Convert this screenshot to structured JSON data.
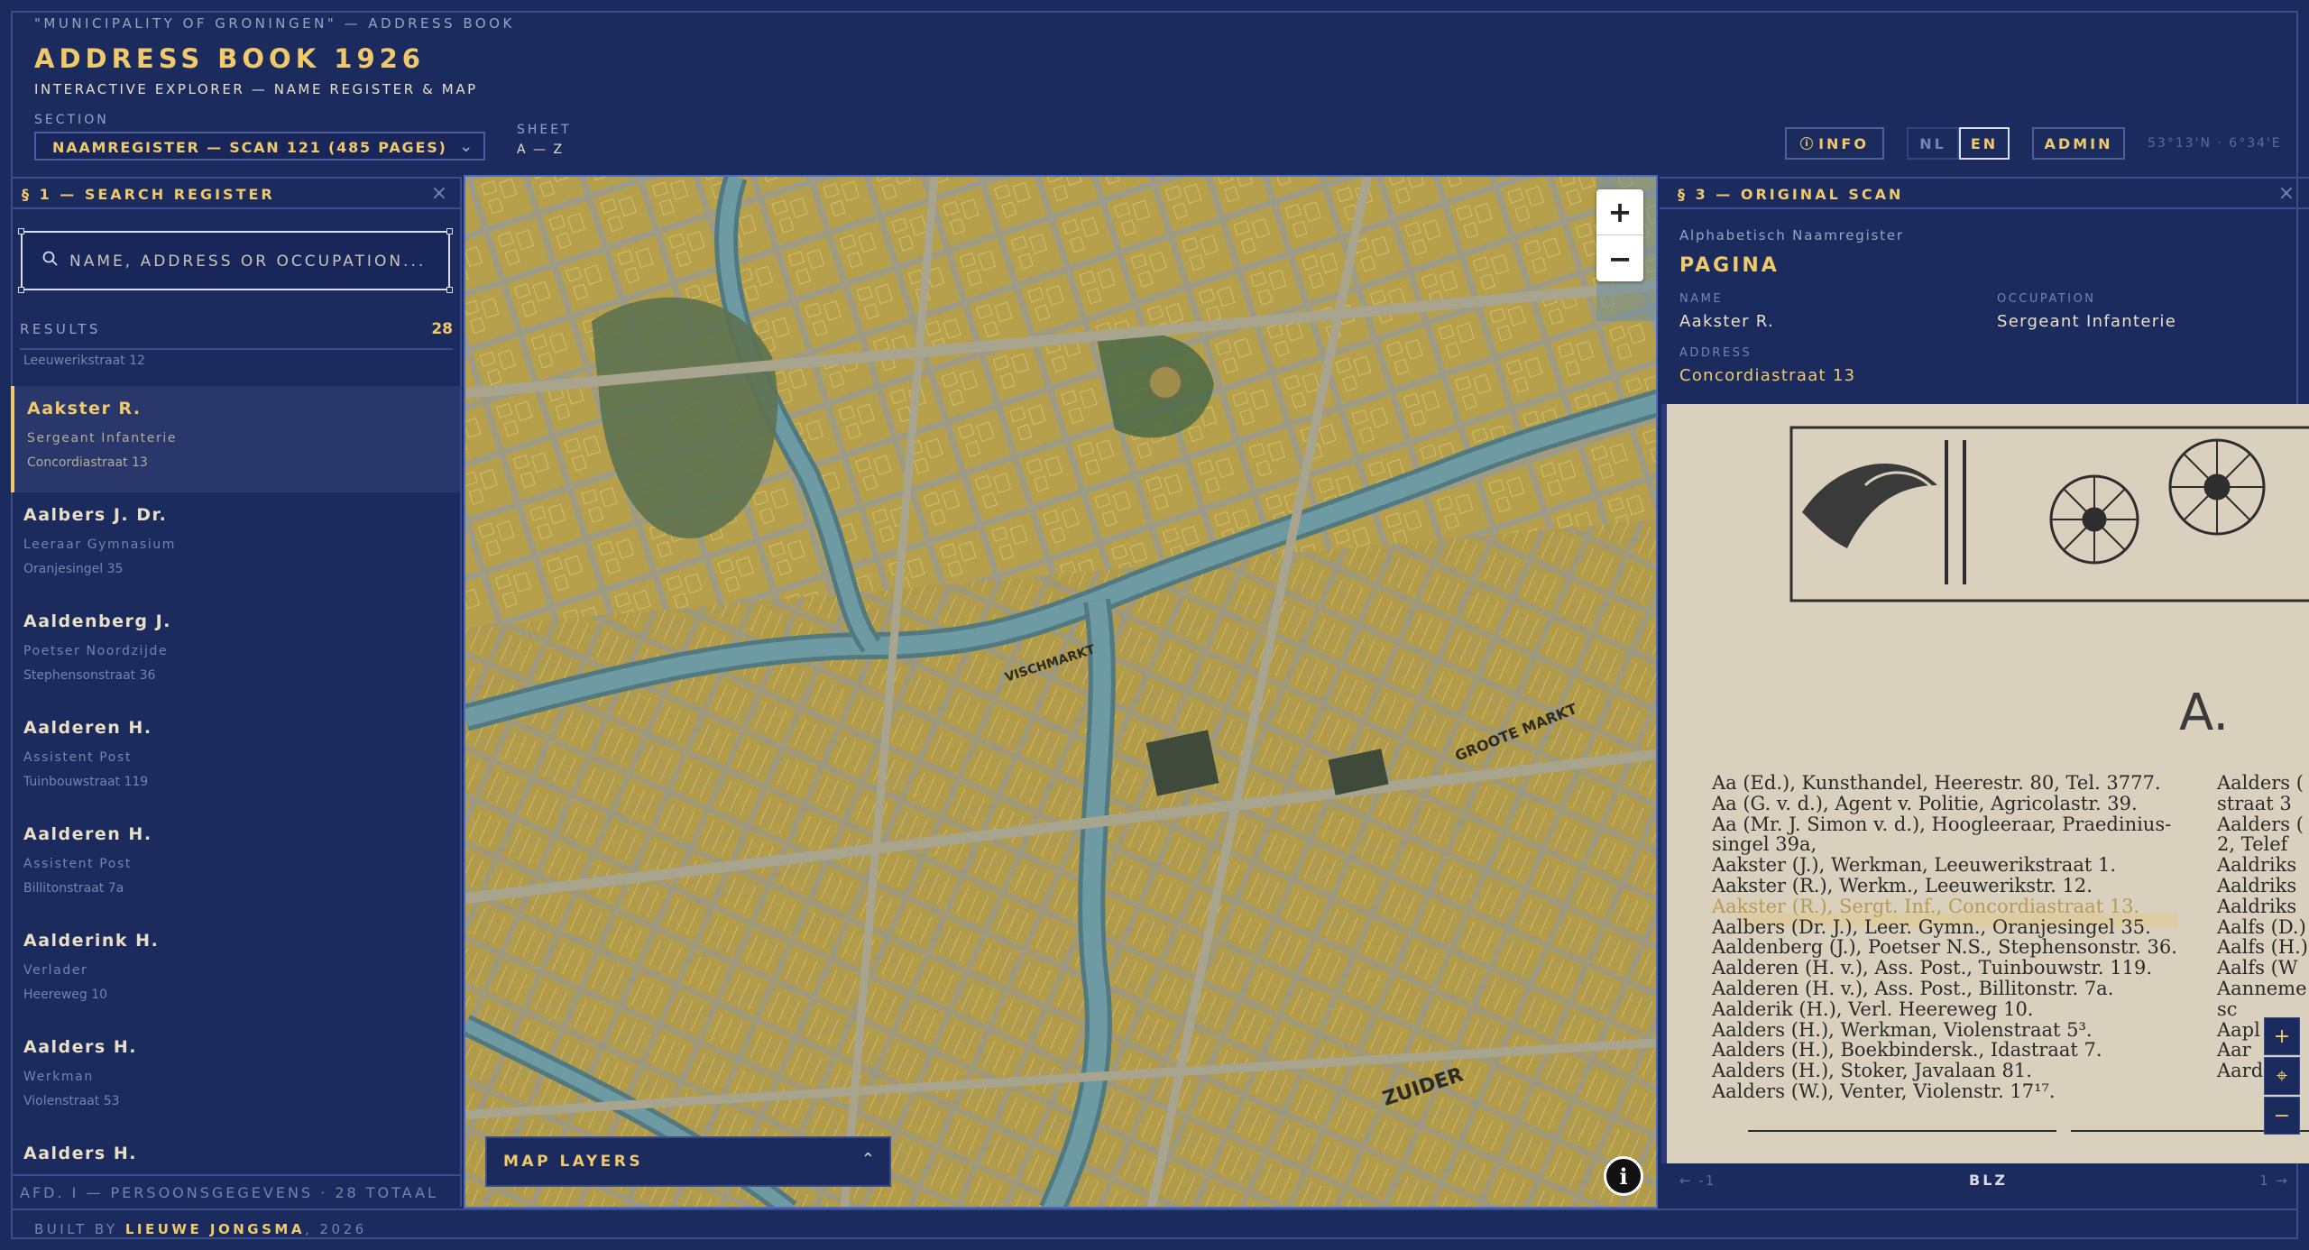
{
  "header": {
    "kicker": "\"MUNICIPALITY OF GRONINGEN\" — ADDRESS BOOK",
    "title": "ADDRESS BOOK 1926",
    "subtitle": "INTERACTIVE EXPLORER — NAME REGISTER & MAP",
    "section_label": "SECTION",
    "section_value": "NAAMREGISTER — SCAN 121 (485 PAGES)",
    "sheet_label": "SHEET",
    "sheet_value": "A — Z",
    "info_label": "INFO",
    "lang_nl": "NL",
    "lang_en": "EN",
    "lang_active": "EN",
    "admin_label": "ADMIN",
    "coords": "53°13'N · 6°34'E"
  },
  "search_panel": {
    "title": "§ 1 — SEARCH REGISTER",
    "close": "×",
    "search_placeholder": "NAME, ADDRESS OR OCCUPATION...",
    "results_label": "RESULTS",
    "results_count": "28",
    "partial_top": "Leeuwerikstraat 12",
    "items": [
      {
        "name": "Aakster R.",
        "occupation": "Sergeant Infanterie",
        "address": "Concordiastraat 13",
        "active": true
      },
      {
        "name": "Aalbers J. Dr.",
        "occupation": "Leeraar Gymnasium",
        "address": "Oranjesingel 35"
      },
      {
        "name": "Aaldenberg J.",
        "occupation": "Poetser Noordzijde",
        "address": "Stephensonstraat 36"
      },
      {
        "name": "Aalderen H.",
        "occupation": "Assistent Post",
        "address": "Tuinbouwstraat 119"
      },
      {
        "name": "Aalderen H.",
        "occupation": "Assistent Post",
        "address": "Billitonstraat 7a"
      },
      {
        "name": "Aalderink H.",
        "occupation": "Verlader",
        "address": "Heereweg 10"
      },
      {
        "name": "Aalders H.",
        "occupation": "Werkman",
        "address": "Violenstraat 53"
      },
      {
        "name": "Aalders H.",
        "occupation": "",
        "address": ""
      }
    ],
    "footer": "AFD. I — PERSOONSGEGEVENS · 28 TOTAAL"
  },
  "map": {
    "zoom_in": "+",
    "zoom_out": "−",
    "layers_label": "MAP LAYERS",
    "layers_chevron": "⌃",
    "info_button": "i",
    "labels": [
      "GROOTE MARKT",
      "ZUIDER",
      "VISCHMARKT"
    ]
  },
  "scan_panel": {
    "title": "§ 3 — ORIGINAL SCAN",
    "close": "×",
    "kicker": "Alphabetisch Naamregister",
    "page_title": "PAGINA",
    "name_label": "NAME",
    "name_value": "Aakster R.",
    "occupation_label": "OCCUPATION",
    "occupation_value": "Sergeant Infanterie",
    "address_label": "ADDRESS",
    "address_value": "Concordiastraat 13",
    "scan_letter": "A.",
    "scan_lines": [
      "Aa (Ed.), Kunsthandel, Heerestr. 80, Tel. 3777.",
      "Aa (G. v. d.), Agent v. Politie, Agricolastr. 39.",
      "Aa (Mr. J. Simon v. d.), Hoogleeraar, Praedinius-",
      "   singel 39a,",
      "Aakster (J.), Werkman, Leeuwerikstraat 1.",
      "Aakster (R.), Werkm., Leeuwerikstr. 12.",
      "Aakster (R.), Sergt. Inf., Concordiastraat 13.",
      "Aalbers (Dr. J.), Leer. Gymn., Oranjesingel 35.",
      "Aaldenberg (J.), Poetser N.S., Stephensonstr. 36.",
      "Aalderen (H. v.), Ass. Post., Tuinbouwstr. 119.",
      "Aalderen (H. v.), Ass. Post., Billitonstr. 7a.",
      "Aalderik (H.), Verl. Heereweg 10.",
      "Aalders (H.), Werkman, Violenstraat 5³.",
      "Aalders (H.), Boekbindersk., Idastraat 7.",
      "Aalders (H.), Stoker, Javalaan 81.",
      "Aalders (W.), Venter, Violenstr. 17¹⁷."
    ],
    "scan_right_lines": [
      "Aalders (",
      "straat 3",
      "Aalders (",
      "2, Telef",
      "Aaldriks",
      "Aaldriks",
      "Aaldriks",
      "Aalfs (D.)",
      "Aalfs (H.)",
      "Aalfs (W",
      "Aanneme",
      "sc",
      "Aapl",
      "Aar",
      "Aard"
    ],
    "scan_zoom_in": "+",
    "scan_zoom_center": "⌖",
    "scan_zoom_out": "−",
    "footer_prev": "← -1",
    "footer_mid": "BLZ",
    "footer_next": "1 →"
  },
  "footer": {
    "credit_prefix": "BUILT BY",
    "credit_name": "LIEUWE JONGSMA",
    "credit_suffix": ", 2026"
  }
}
